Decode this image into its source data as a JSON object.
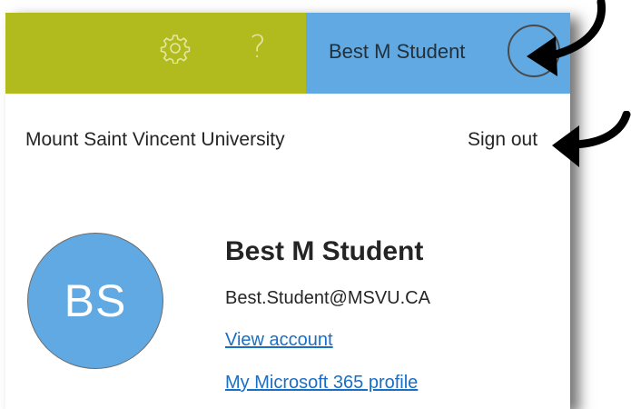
{
  "header": {
    "settings_icon": "gear-icon",
    "help_label": "?",
    "account_name": "Best M Student",
    "left_color": "#b2bb1e",
    "right_color": "#61a9e3"
  },
  "account_panel": {
    "organization": "Mount Saint Vincent University",
    "sign_out_label": "Sign out",
    "avatar_initials": "BS",
    "display_name": "Best M Student",
    "email": "Best.Student@MSVU.CA",
    "view_account_label": "View account",
    "profile_link_label": "My Microsoft 365 profile"
  }
}
